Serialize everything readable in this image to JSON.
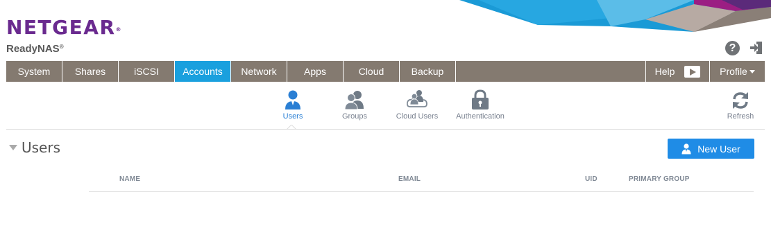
{
  "brand": {
    "logo": "NETGEAR",
    "logo_mark": "®",
    "product": "ReadyNAS",
    "product_mark": "®"
  },
  "colors": {
    "brand_purple": "#6a2a8f",
    "nav_bg": "#847a70",
    "nav_active": "#1aa0de",
    "primary_button": "#1f8ce6"
  },
  "header": {
    "help_icon": "question-circle-icon",
    "help_glyph": "?",
    "logout_icon": "logout-icon"
  },
  "nav": {
    "items": [
      {
        "label": "System"
      },
      {
        "label": "Shares"
      },
      {
        "label": "iSCSI"
      },
      {
        "label": "Accounts",
        "active": true
      },
      {
        "label": "Network"
      },
      {
        "label": "Apps"
      },
      {
        "label": "Cloud"
      },
      {
        "label": "Backup"
      }
    ],
    "help_label": "Help",
    "help_icon": "play-icon",
    "profile_label": "Profile"
  },
  "subnav": {
    "items": [
      {
        "label": "Users",
        "icon": "user-icon",
        "active": true
      },
      {
        "label": "Groups",
        "icon": "group-icon"
      },
      {
        "label": "Cloud Users",
        "icon": "cloud-users-icon"
      },
      {
        "label": "Authentication",
        "icon": "lock-icon"
      }
    ],
    "refresh_label": "Refresh",
    "refresh_icon": "refresh-icon"
  },
  "section": {
    "title": "Users",
    "new_user_label": "New User",
    "new_user_icon": "user-icon"
  },
  "table": {
    "columns": [
      "NAME",
      "EMAIL",
      "UID",
      "PRIMARY GROUP"
    ],
    "rows": []
  }
}
